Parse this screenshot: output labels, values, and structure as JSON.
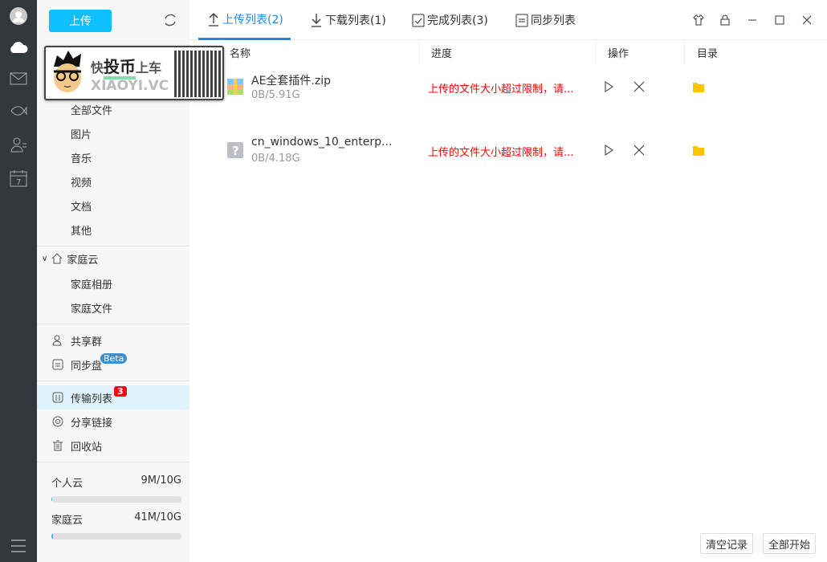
{
  "sidebar": {
    "upload_label": "上传",
    "categories": [
      "全部文件",
      "图片",
      "音乐",
      "视频",
      "文档",
      "其他"
    ],
    "family": {
      "title": "家庭云",
      "items": [
        "家庭相册",
        "家庭文件"
      ]
    },
    "share_group": "共享群",
    "sync_disk": "同步盘",
    "beta": "Beta",
    "transfer": "传输列表",
    "transfer_badge": "3",
    "share_link": "分享链接",
    "recycle": "回收站",
    "quota": [
      {
        "label": "个人云",
        "value": "9M/10G",
        "fraction": 0.001
      },
      {
        "label": "家庭云",
        "value": "41M/10G",
        "fraction": 0.004
      }
    ]
  },
  "watermark": {
    "line1a": "快",
    "line1b": "投币",
    "line1c": "上车",
    "line2": "XIAOYI.VC"
  },
  "tabs": [
    "上传列表(2)",
    "下载列表(1)",
    "完成列表(3)",
    "同步列表"
  ],
  "columns": [
    "名称",
    "进度",
    "操作",
    "目录"
  ],
  "files": [
    {
      "name": "AE全套插件.zip",
      "size": "0B/5.91G",
      "status": "上传的文件大小超过限制，请..."
    },
    {
      "name": "cn_windows_10_enterp...",
      "size": "0B/4.18G",
      "status": "上传的文件大小超过限制，请..."
    }
  ],
  "footer": {
    "clear": "清空记录",
    "start_all": "全部开始"
  },
  "colors": {
    "accent": "#1a8ce8",
    "upload": "#0fc0ff",
    "error": "#ff0000",
    "folder": "#ffc400"
  }
}
